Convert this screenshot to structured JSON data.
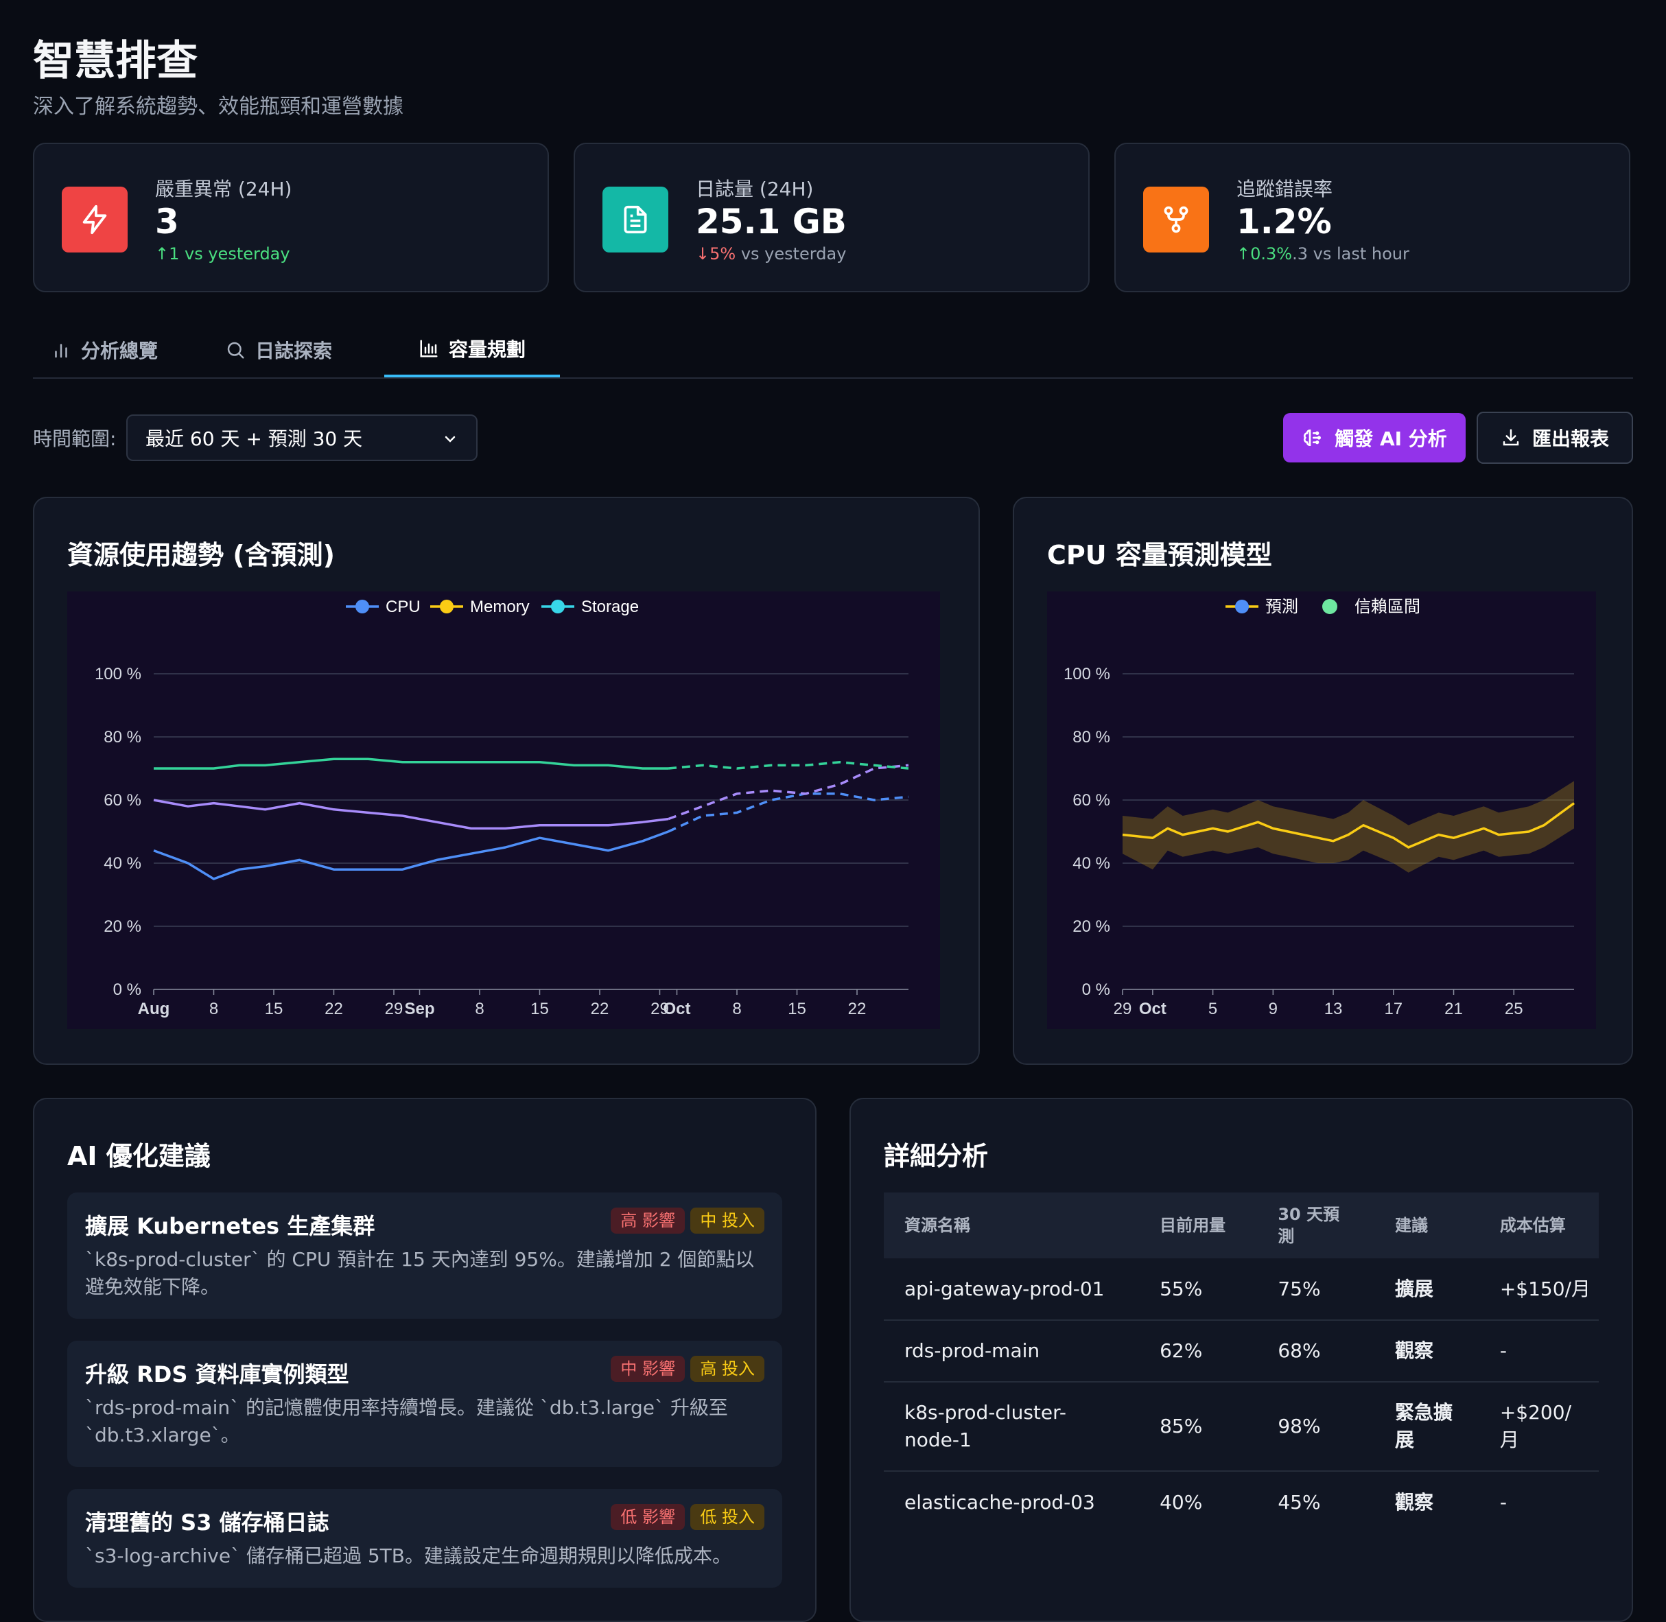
{
  "header": {
    "title": "智慧排查",
    "subtitle": "深入了解系統趨勢、效能瓶頸和運營數據"
  },
  "kpis": [
    {
      "label": "嚴重異常 (24H)",
      "value": "3",
      "delta": "↑1",
      "delta_suffix": " vs yesterday",
      "icon": "lightning-icon",
      "color": "#ef4444"
    },
    {
      "label": "日誌量 (24H)",
      "value": "25.1 GB",
      "delta": "↓5%",
      "delta_suffix": " vs yesterday",
      "icon": "document-icon",
      "color": "#14b8a6"
    },
    {
      "label": "追蹤錯誤率",
      "value": "1.2%",
      "delta": "↑0.3%",
      "delta_suffix": ".3 vs last hour",
      "icon": "git-fork-icon",
      "color": "#f97316"
    }
  ],
  "tabs": [
    {
      "label": "分析總覽",
      "icon": "bar-chart-icon"
    },
    {
      "label": "日誌探索",
      "icon": "search-icon"
    },
    {
      "label": "容量規劃",
      "icon": "column-chart-icon",
      "active": true
    }
  ],
  "toolbar": {
    "range_label": "時間範圍:",
    "range_value": "最近 60 天 + 預測 30 天",
    "ai_button": "觸發 AI 分析",
    "export_button": "匯出報表"
  },
  "panels": {
    "trend_title": "資源使用趨勢 (含預測)",
    "cpu_title": "CPU 容量預測模型",
    "recs_title": "AI 優化建議",
    "detail_title": "詳細分析"
  },
  "chart_data": [
    {
      "type": "line",
      "title": "資源使用趨勢 (含預測)",
      "legend": [
        "CPU",
        "Memory",
        "Storage"
      ],
      "legend_position": "top-center",
      "ylim": [
        0,
        100
      ],
      "y_ticks": [
        "0 %",
        "20 %",
        "40 %",
        "60 %",
        "80 %",
        "100 %"
      ],
      "x_ticks": [
        "Aug",
        "8",
        "15",
        "22",
        "29",
        "Sep",
        "8",
        "15",
        "22",
        "29",
        "Oct",
        "8",
        "15",
        "22"
      ],
      "grid": true,
      "forecast_start": "2024-09-30",
      "x_range": [
        "2024-08-01",
        "2024-10-28"
      ],
      "series": [
        {
          "name": "CPU",
          "color": "#4f8ff7",
          "x": [
            "2024-08-01",
            "2024-08-05",
            "2024-08-08",
            "2024-08-11",
            "2024-08-14",
            "2024-08-18",
            "2024-08-22",
            "2024-08-26",
            "2024-08-30",
            "2024-09-03",
            "2024-09-07",
            "2024-09-11",
            "2024-09-15",
            "2024-09-19",
            "2024-09-23",
            "2024-09-27",
            "2024-09-30",
            "2024-10-04",
            "2024-10-08",
            "2024-10-12",
            "2024-10-16",
            "2024-10-20",
            "2024-10-24",
            "2024-10-28"
          ],
          "values": [
            44,
            40,
            35,
            38,
            39,
            41,
            38,
            38,
            38,
            41,
            43,
            45,
            48,
            46,
            44,
            47,
            50,
            55,
            56,
            60,
            62,
            62,
            60,
            61
          ]
        },
        {
          "name": "Memory",
          "color": "#a78bfa",
          "x": [
            "2024-08-01",
            "2024-08-05",
            "2024-08-08",
            "2024-08-11",
            "2024-08-14",
            "2024-08-18",
            "2024-08-22",
            "2024-08-26",
            "2024-08-30",
            "2024-09-03",
            "2024-09-07",
            "2024-09-11",
            "2024-09-15",
            "2024-09-19",
            "2024-09-23",
            "2024-09-27",
            "2024-09-30",
            "2024-10-04",
            "2024-10-08",
            "2024-10-12",
            "2024-10-16",
            "2024-10-20",
            "2024-10-24",
            "2024-10-28"
          ],
          "values": [
            60,
            58,
            59,
            58,
            57,
            59,
            57,
            56,
            55,
            53,
            51,
            51,
            52,
            52,
            52,
            53,
            54,
            58,
            62,
            63,
            62,
            65,
            70,
            71
          ]
        },
        {
          "name": "Storage",
          "color": "#34d399",
          "x": [
            "2024-08-01",
            "2024-08-05",
            "2024-08-08",
            "2024-08-11",
            "2024-08-14",
            "2024-08-18",
            "2024-08-22",
            "2024-08-26",
            "2024-08-30",
            "2024-09-03",
            "2024-09-07",
            "2024-09-11",
            "2024-09-15",
            "2024-09-19",
            "2024-09-23",
            "2024-09-27",
            "2024-09-30",
            "2024-10-04",
            "2024-10-08",
            "2024-10-12",
            "2024-10-16",
            "2024-10-20",
            "2024-10-24",
            "2024-10-28"
          ],
          "values": [
            70,
            70,
            70,
            71,
            71,
            72,
            73,
            73,
            72,
            72,
            72,
            72,
            72,
            71,
            71,
            70,
            70,
            71,
            70,
            71,
            71,
            72,
            71,
            70
          ]
        }
      ]
    },
    {
      "type": "area",
      "title": "CPU 容量預測模型",
      "legend": [
        "預測",
        "信賴區間"
      ],
      "legend_position": "top-center",
      "ylim": [
        0,
        100
      ],
      "y_ticks": [
        "0 %",
        "20 %",
        "40 %",
        "60 %",
        "80 %",
        "100 %"
      ],
      "x_ticks": [
        "29",
        "Oct",
        "5",
        "9",
        "13",
        "17",
        "21",
        "25"
      ],
      "grid": true,
      "x_range": [
        "2024-09-29",
        "2024-10-29"
      ],
      "series": [
        {
          "name": "預測",
          "color": "#facc15",
          "x": [
            "2024-09-29",
            "2024-10-01",
            "2024-10-02",
            "2024-10-03",
            "2024-10-05",
            "2024-10-06",
            "2024-10-08",
            "2024-10-09",
            "2024-10-10",
            "2024-10-12",
            "2024-10-13",
            "2024-10-14",
            "2024-10-15",
            "2024-10-17",
            "2024-10-18",
            "2024-10-20",
            "2024-10-21",
            "2024-10-23",
            "2024-10-24",
            "2024-10-26",
            "2024-10-27",
            "2024-10-29"
          ],
          "values": [
            49,
            48,
            51,
            49,
            51,
            50,
            53,
            51,
            50,
            48,
            47,
            49,
            52,
            48,
            45,
            49,
            48,
            51,
            49,
            50,
            52,
            59
          ]
        },
        {
          "name": "信賴區間",
          "color": "#8b6e1d",
          "upper": [
            55,
            54,
            58,
            55,
            57,
            56,
            60,
            58,
            57,
            55,
            54,
            56,
            60,
            55,
            52,
            56,
            55,
            58,
            56,
            58,
            60,
            66
          ],
          "lower": [
            43,
            38,
            44,
            42,
            44,
            43,
            45,
            43,
            42,
            40,
            40,
            41,
            44,
            40,
            37,
            42,
            41,
            44,
            42,
            43,
            45,
            51
          ]
        }
      ]
    }
  ],
  "recommendations": [
    {
      "title": "擴展 Kubernetes 生產集群",
      "impact": "高 影響",
      "impact_color": "red",
      "effort": "中 投入",
      "desc": "`k8s-prod-cluster` 的 CPU 預計在 15 天內達到 95%。建議增加 2 個節點以避免效能下降。"
    },
    {
      "title": "升級 RDS 資料庫實例類型",
      "impact": "中 影響",
      "impact_color": "red",
      "effort": "高 投入",
      "desc": "`rds-prod-main` 的記憶體使用率持續增長。建議從 `db.t3.large` 升級至 `db.t3.xlarge`。"
    },
    {
      "title": "清理舊的 S3 儲存桶日誌",
      "impact": "低 影響",
      "impact_color": "red",
      "effort": "低 投入",
      "desc": "`s3-log-archive` 儲存桶已超過 5TB。建議設定生命週期規則以降低成本。"
    }
  ],
  "detail_table": {
    "headers": [
      "資源名稱",
      "目前用量",
      "30 天預測",
      "建議",
      "成本估算"
    ],
    "rows": [
      {
        "name": "api-gateway-prod-01",
        "current": "55%",
        "forecast": "75%",
        "action": "擴展",
        "action_color": "orange",
        "cost": "+$150/月"
      },
      {
        "name": "rds-prod-main",
        "current": "62%",
        "forecast": "68%",
        "action": "觀察",
        "action_color": "white",
        "cost": "-"
      },
      {
        "name": "k8s-prod-cluster-node-1",
        "current": "85%",
        "forecast": "98%",
        "action": "緊急擴展",
        "action_color": "red",
        "cost": "+$200/月"
      },
      {
        "name": "elasticache-prod-03",
        "current": "40%",
        "forecast": "45%",
        "action": "觀察",
        "action_color": "white",
        "cost": "-"
      }
    ]
  }
}
